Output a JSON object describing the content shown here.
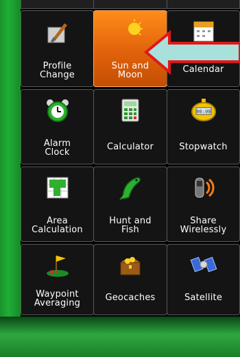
{
  "menu": {
    "tiles": [
      {
        "label": "Profile\nChange",
        "icon": "paintbrush-icon"
      },
      {
        "label": "Sun and\nMoon",
        "icon": "sun-moon-icon",
        "selected": true
      },
      {
        "label": "Calendar",
        "icon": "calendar-icon"
      },
      {
        "label": "Alarm\nClock",
        "icon": "alarm-clock-icon"
      },
      {
        "label": "Calculator",
        "icon": "calculator-icon"
      },
      {
        "label": "Stopwatch",
        "icon": "stopwatch-icon"
      },
      {
        "label": "Area\nCalculation",
        "icon": "area-calculation-icon"
      },
      {
        "label": "Hunt and\nFish",
        "icon": "fish-icon"
      },
      {
        "label": "Share\nWirelessly",
        "icon": "share-wireless-icon"
      },
      {
        "label": "Waypoint\nAveraging",
        "icon": "waypoint-flag-icon"
      },
      {
        "label": "Geocaches",
        "icon": "treasure-chest-icon"
      },
      {
        "label": "Satellite",
        "icon": "satellite-icon"
      }
    ]
  },
  "annotation": {
    "icon": "arrow-left-icon",
    "color": "#e01818",
    "fill": "#a8e0dc"
  },
  "colors": {
    "selected_tile": "#e0620a",
    "background": "#1f7a2c"
  }
}
